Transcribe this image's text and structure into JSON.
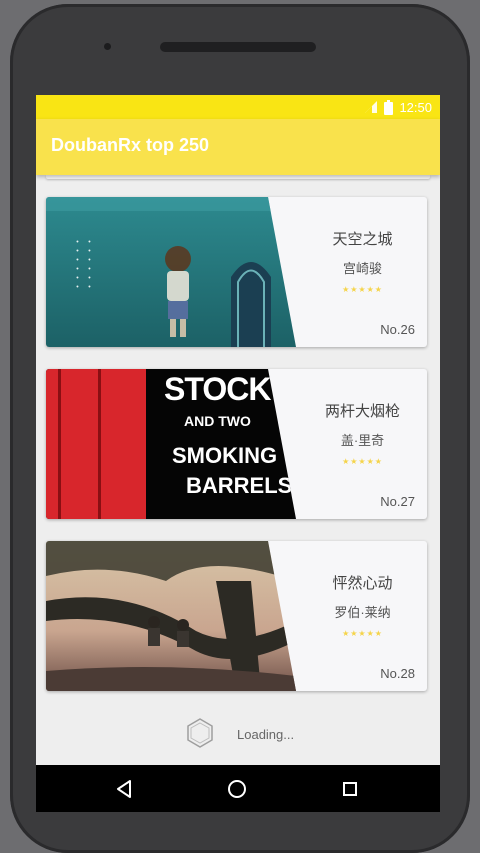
{
  "status_bar": {
    "time": "12:50",
    "icons": [
      "wifi-icon",
      "battery-icon"
    ]
  },
  "app_bar": {
    "title": "DoubanRx top 250"
  },
  "movies": [
    {
      "title": "天空之城",
      "director": "宫崎骏",
      "stars": "★★★★★",
      "rank": "No.26"
    },
    {
      "title": "两杆大烟枪",
      "director": "盖·里奇",
      "stars": "★★★★★",
      "rank": "No.27",
      "poster_text": [
        "STOCK",
        "AND TWO",
        "SMOKING",
        "BARRELS"
      ]
    },
    {
      "title": "怦然心动",
      "director": "罗伯·莱纳",
      "stars": "★★★★★",
      "rank": "No.28"
    }
  ],
  "footer": {
    "loading_text": "Loading..."
  },
  "nav_bar": {
    "buttons": [
      "back-icon",
      "home-icon",
      "recents-icon"
    ]
  },
  "colors": {
    "primary": "#f9e24c",
    "status_bar": "#f9e514",
    "star": "#f5d44a"
  }
}
